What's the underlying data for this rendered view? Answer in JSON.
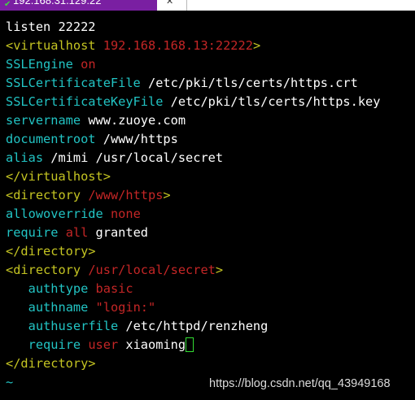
{
  "tab": {
    "title": "192.168.31.129:22",
    "check_icon": "check-icon",
    "close_icon": "close-icon"
  },
  "colors": {
    "background": "#000000",
    "tab": "#7a1fa2",
    "text": "#ffffff",
    "keyword": "#22c4c4",
    "value": "#c42626",
    "tag": "#c4c422",
    "cursor": "#33dd33"
  },
  "terminal": {
    "lines": [
      [
        {
          "t": "listen 22222",
          "c": "w"
        }
      ],
      [
        {
          "t": "<virtualhost ",
          "c": "y"
        },
        {
          "t": "192.168.168.13:22222",
          "c": "r"
        },
        {
          "t": ">",
          "c": "y"
        }
      ],
      [
        {
          "t": "SSLEngine ",
          "c": "c"
        },
        {
          "t": "on",
          "c": "r"
        }
      ],
      [
        {
          "t": "SSLCertificateFile ",
          "c": "c"
        },
        {
          "t": "/etc/pki/tls/certs/https.crt",
          "c": "w"
        }
      ],
      [
        {
          "t": "SSLCertificateKeyFile ",
          "c": "c"
        },
        {
          "t": "/etc/pki/tls/certs/https.key",
          "c": "w"
        }
      ],
      [
        {
          "t": "servername ",
          "c": "c"
        },
        {
          "t": "www.zuoye.com",
          "c": "w"
        }
      ],
      [
        {
          "t": "documentroot ",
          "c": "c"
        },
        {
          "t": "/www/https",
          "c": "w"
        }
      ],
      [
        {
          "t": "alias ",
          "c": "c"
        },
        {
          "t": "/mimi /usr/local/secret",
          "c": "w"
        }
      ],
      [
        {
          "t": "</virtualhost>",
          "c": "y"
        }
      ],
      [
        {
          "t": "<directory ",
          "c": "y"
        },
        {
          "t": "/www/https",
          "c": "r"
        },
        {
          "t": ">",
          "c": "y"
        }
      ],
      [
        {
          "t": "allowoverride ",
          "c": "c"
        },
        {
          "t": "none",
          "c": "r"
        }
      ],
      [
        {
          "t": "require ",
          "c": "c"
        },
        {
          "t": "all",
          "c": "r"
        },
        {
          "t": " granted",
          "c": "w"
        }
      ],
      [
        {
          "t": "</directory>",
          "c": "y"
        }
      ],
      [
        {
          "t": "<directory ",
          "c": "y"
        },
        {
          "t": "/usr/local/secret",
          "c": "r"
        },
        {
          "t": ">",
          "c": "y"
        }
      ],
      [
        {
          "t": "   ",
          "c": "w"
        },
        {
          "t": "authtype ",
          "c": "c"
        },
        {
          "t": "basic",
          "c": "r"
        }
      ],
      [
        {
          "t": "   ",
          "c": "w"
        },
        {
          "t": "authname ",
          "c": "c"
        },
        {
          "t": "\"login:\"",
          "c": "r"
        }
      ],
      [
        {
          "t": "   ",
          "c": "w"
        },
        {
          "t": "authuserfile ",
          "c": "c"
        },
        {
          "t": "/etc/httpd/renzheng",
          "c": "w"
        }
      ],
      [
        {
          "t": "   ",
          "c": "w"
        },
        {
          "t": "require ",
          "c": "c"
        },
        {
          "t": "user ",
          "c": "r"
        },
        {
          "t": "xiaoming",
          "c": "w"
        }
      ],
      [
        {
          "t": "</directory>",
          "c": "y"
        }
      ],
      [
        {
          "t": "~",
          "c": "c"
        }
      ]
    ],
    "cursor_line": 17
  },
  "watermark": "https://blog.csdn.net/qq_43949168"
}
